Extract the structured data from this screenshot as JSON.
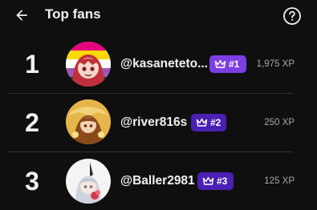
{
  "header": {
    "title": "Top fans"
  },
  "fans": [
    {
      "rank": "1",
      "username": "@kasaneteto...",
      "badge": "#1",
      "xp": "1,975 XP",
      "badge_color": "#7b3fe4"
    },
    {
      "rank": "2",
      "username": "@river816s",
      "badge": "#2",
      "xp": "250 XP",
      "badge_color": "#4a1fb3"
    },
    {
      "rank": "3",
      "username": "@Baller2981",
      "badge": "#3",
      "xp": "125 XP",
      "badge_color": "#4a1fb3"
    }
  ],
  "colors": {
    "background": "#0f0f0f",
    "text": "#f1f1f1",
    "muted": "#aaaaaa",
    "badge_top": "#7b3fe4",
    "badge_other": "#4a1fb3"
  },
  "icons": {
    "back": "arrow-left-icon",
    "help": "question-circle-icon",
    "badge": "crown-icon"
  }
}
